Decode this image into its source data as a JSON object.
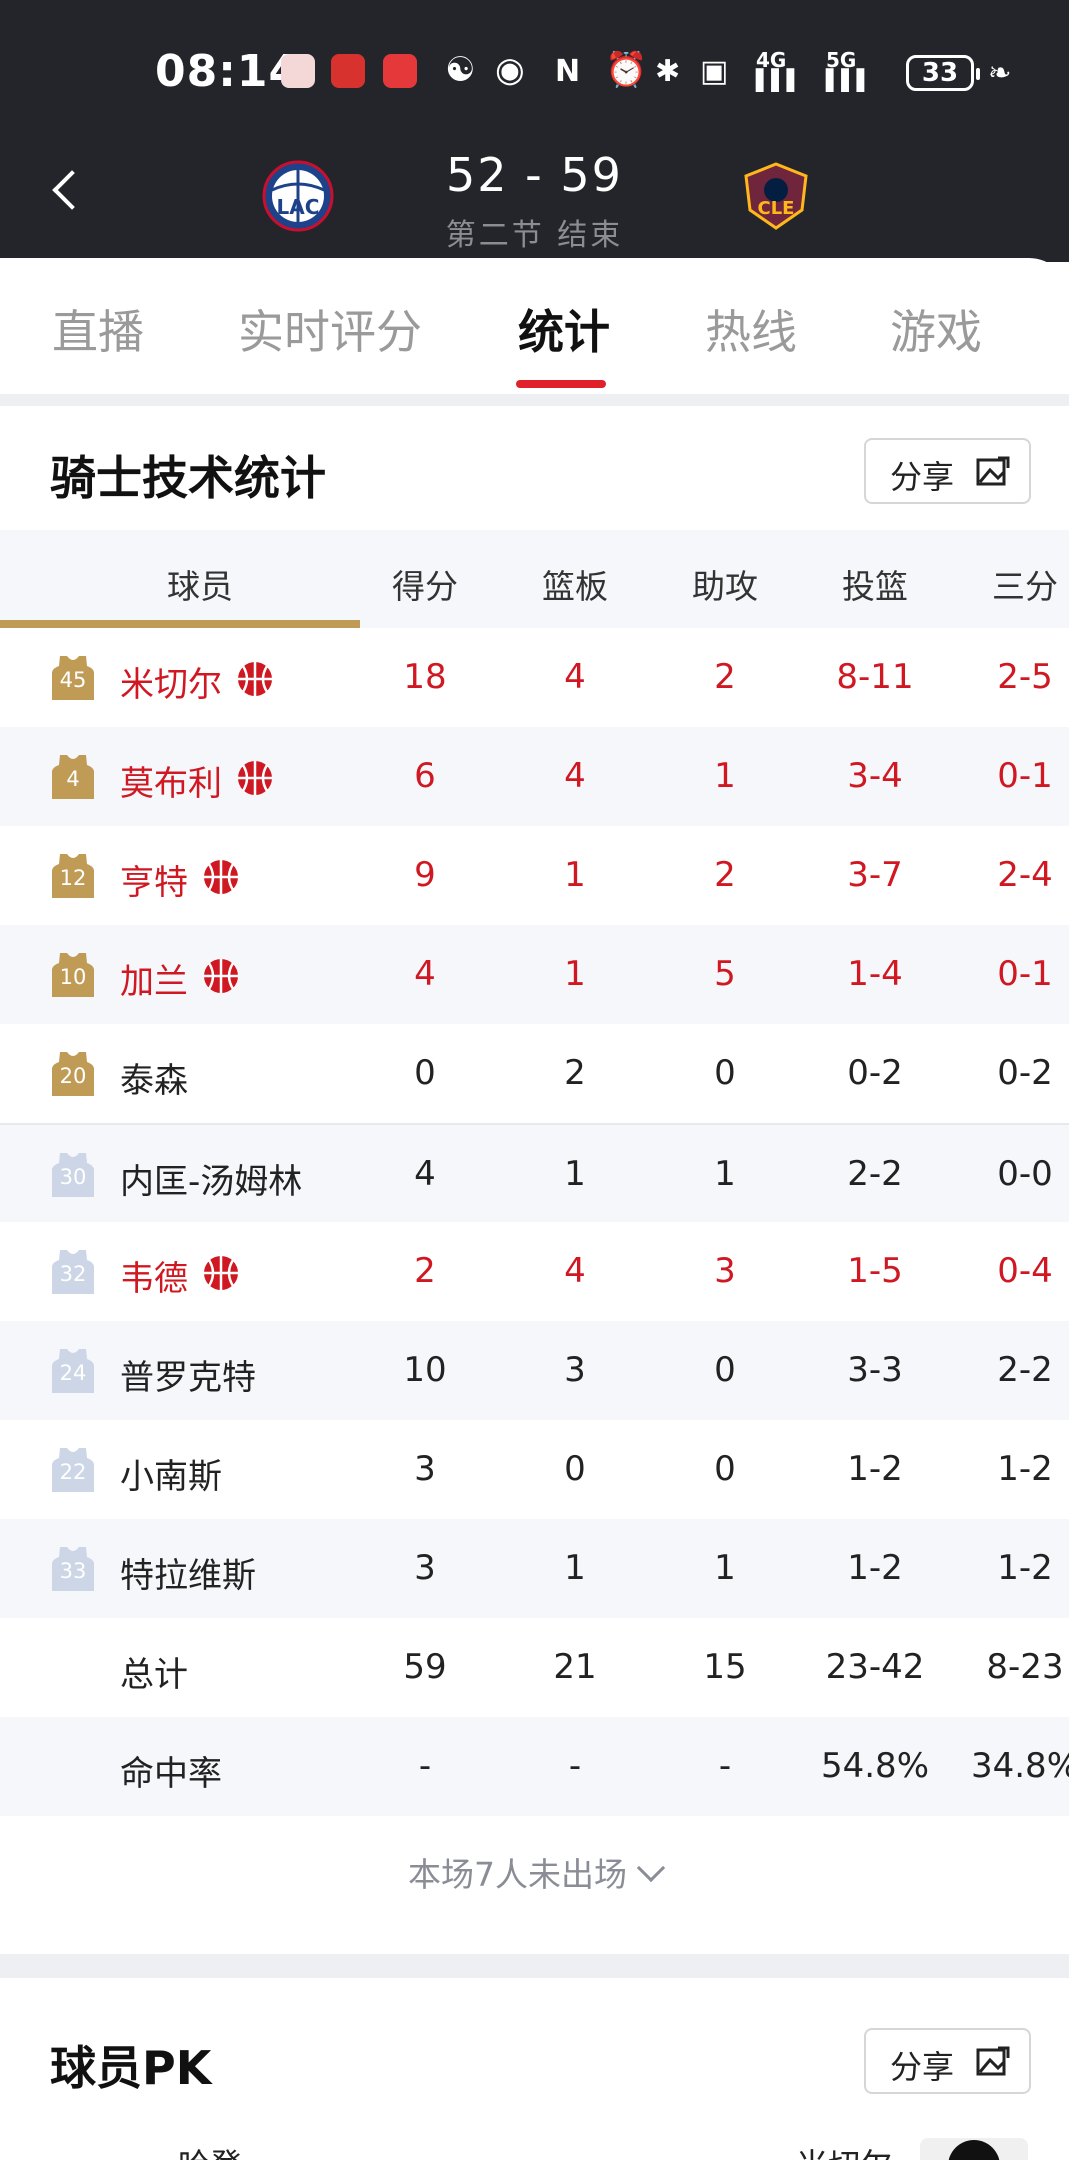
{
  "status_bar": {
    "time": "08:14",
    "net1": "4G",
    "net2": "5G",
    "battery": "33"
  },
  "game": {
    "score": "52 - 59",
    "period": "第二节 结束",
    "home_logo_text": "LAC",
    "away_logo_text": "CLE"
  },
  "tabs": [
    "直播",
    "实时评分",
    "统计",
    "热线",
    "游戏"
  ],
  "active_tab": "统计",
  "section": {
    "title": "骑士技术统计",
    "share_label": "分享"
  },
  "table": {
    "headers": [
      "球员",
      "得分",
      "篮板",
      "助攻",
      "投篮",
      "三分"
    ],
    "rows": [
      {
        "number": "45",
        "name": "米切尔",
        "starter": true,
        "highlight": true,
        "stats": [
          "18",
          "4",
          "2",
          "8-11",
          "2-5"
        ]
      },
      {
        "number": "4",
        "name": "莫布利",
        "starter": true,
        "highlight": true,
        "stats": [
          "6",
          "4",
          "1",
          "3-4",
          "0-1"
        ]
      },
      {
        "number": "12",
        "name": "亨特",
        "starter": true,
        "highlight": true,
        "stats": [
          "9",
          "1",
          "2",
          "3-7",
          "2-4"
        ]
      },
      {
        "number": "10",
        "name": "加兰",
        "starter": true,
        "highlight": true,
        "stats": [
          "4",
          "1",
          "5",
          "1-4",
          "0-1"
        ]
      },
      {
        "number": "20",
        "name": "泰森",
        "starter": true,
        "highlight": false,
        "stats": [
          "0",
          "2",
          "0",
          "0-2",
          "0-2"
        ]
      },
      {
        "number": "30",
        "name": "内匡-汤姆林",
        "starter": false,
        "highlight": false,
        "stats": [
          "4",
          "1",
          "1",
          "2-2",
          "0-0"
        ]
      },
      {
        "number": "32",
        "name": "韦德",
        "starter": false,
        "highlight": true,
        "stats": [
          "2",
          "4",
          "3",
          "1-5",
          "0-4"
        ]
      },
      {
        "number": "24",
        "name": "普罗克特",
        "starter": false,
        "highlight": false,
        "stats": [
          "10",
          "3",
          "0",
          "3-3",
          "2-2"
        ]
      },
      {
        "number": "22",
        "name": "小南斯",
        "starter": false,
        "highlight": false,
        "stats": [
          "3",
          "0",
          "0",
          "1-2",
          "1-2"
        ]
      },
      {
        "number": "33",
        "name": "特拉维斯",
        "starter": false,
        "highlight": false,
        "stats": [
          "3",
          "1",
          "1",
          "1-2",
          "1-2"
        ]
      }
    ],
    "total": {
      "label": "总计",
      "stats": [
        "59",
        "21",
        "15",
        "23-42",
        "8-23"
      ]
    },
    "percent": {
      "label": "命中率",
      "stats": [
        "-",
        "-",
        "-",
        "54.8%",
        "34.8%"
      ]
    }
  },
  "not_played": "本场7人未出场",
  "pk_section": {
    "title": "球员PK",
    "share_label": "分享",
    "left_player": "哈登",
    "right_player": "米切尔"
  },
  "colors": {
    "header_bg": "#23252a",
    "highlight_red": "#d01822",
    "starter_gold": "#c09b56",
    "bench_blue": "#cdd6e6",
    "tab_active": "#e0202a"
  }
}
